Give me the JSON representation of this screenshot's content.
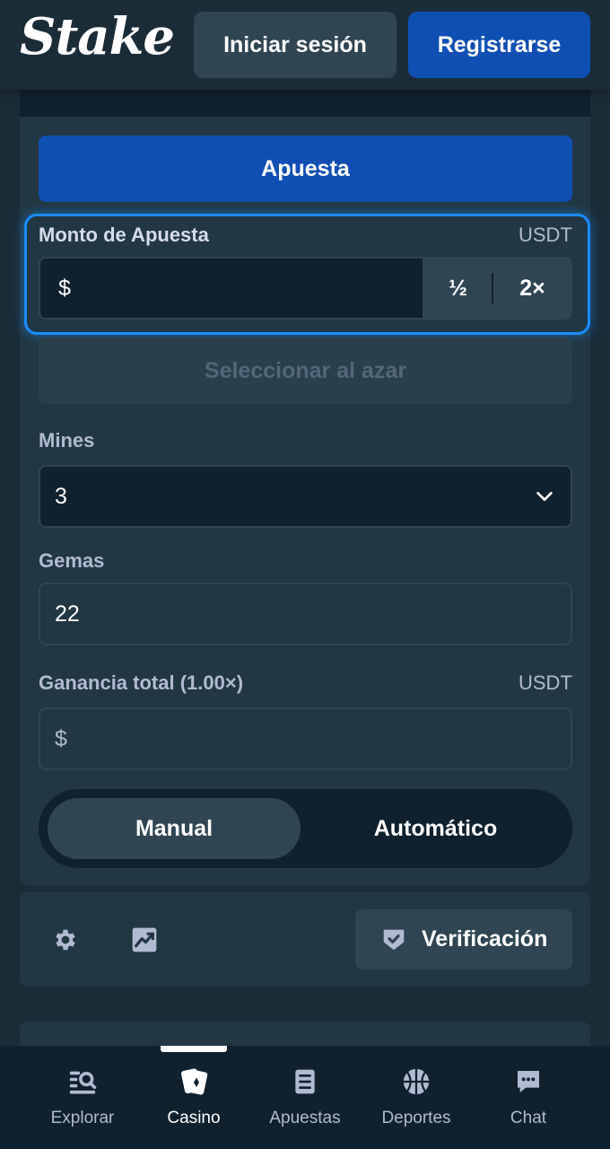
{
  "header": {
    "logo": "Stake",
    "login_label": "Iniciar sesión",
    "register_label": "Registrarse"
  },
  "bet_panel": {
    "bet_tab_label": "Apuesta",
    "amount_label": "Monto de Apuesta",
    "amount_currency": "USDT",
    "amount_prefix": "$",
    "amount_value": "",
    "half_label": "½",
    "double_label": "2×",
    "random_label": "Seleccionar al azar",
    "mines_label": "Mines",
    "mines_value": "3",
    "gems_label": "Gemas",
    "gems_value": "22",
    "profit_label": "Ganancia total (1.00×)",
    "profit_currency": "USDT",
    "profit_prefix": "$",
    "mode_manual": "Manual",
    "mode_auto": "Automático",
    "active_mode": "Manual"
  },
  "footer_panel": {
    "settings_icon": "gear-icon",
    "stats_icon": "chart-icon",
    "verification_label": "Verificación"
  },
  "bottom_nav": {
    "items": [
      {
        "label": "Explorar",
        "icon": "explore-icon"
      },
      {
        "label": "Casino",
        "icon": "cards-icon",
        "active": true
      },
      {
        "label": "Apuestas",
        "icon": "betslip-icon"
      },
      {
        "label": "Deportes",
        "icon": "ball-icon"
      },
      {
        "label": "Chat",
        "icon": "chat-icon"
      }
    ]
  },
  "colors": {
    "background": "#1a2c38",
    "panel": "#213743",
    "input": "#0f212e",
    "accent_blue": "#0f4fb3",
    "focus_blue": "#1a8cff",
    "muted_text": "#b1bad3"
  }
}
